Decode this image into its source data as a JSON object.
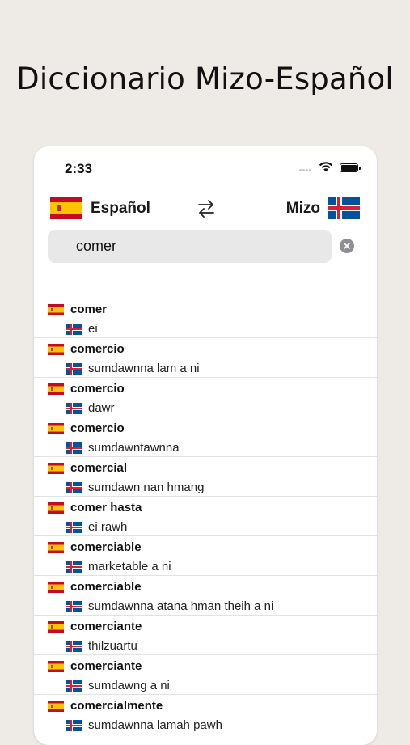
{
  "promo": {
    "title": "Diccionario Mizo-Español"
  },
  "status_bar": {
    "time": "2:33"
  },
  "lang_bar": {
    "from_label": "Español",
    "to_label": "Mizo"
  },
  "search": {
    "value": "comer"
  },
  "icons": {
    "swap": "swap-arrows-icon",
    "clear": "clear-circle-x-icon",
    "wifi": "wifi-icon",
    "battery": "battery-icon",
    "flag_source": "spain-flag-icon",
    "flag_target": "iceland-flag-icon"
  },
  "colors": {
    "spain_red": "#c60b1e",
    "spain_yellow": "#ffc400",
    "iceland_blue": "#02529c",
    "iceland_red": "#dc1e35"
  },
  "results": [
    {
      "src": "comer",
      "dst": "ei"
    },
    {
      "src": "comercio",
      "dst": "sumdawnna lam a ni"
    },
    {
      "src": "comercio",
      "dst": "dawr"
    },
    {
      "src": "comercio",
      "dst": "sumdawntawnna"
    },
    {
      "src": "comercial",
      "dst": "sumdawn nan hmang"
    },
    {
      "src": "comer hasta",
      "dst": "ei rawh"
    },
    {
      "src": "comerciable",
      "dst": "marketable a ni"
    },
    {
      "src": "comerciable",
      "dst": "sumdawnna atana hman theih a ni"
    },
    {
      "src": "comerciante",
      "dst": "thilzuartu"
    },
    {
      "src": "comerciante",
      "dst": "sumdawng a ni"
    },
    {
      "src": "comercialmente",
      "dst": "sumdawnna lamah pawh"
    }
  ]
}
